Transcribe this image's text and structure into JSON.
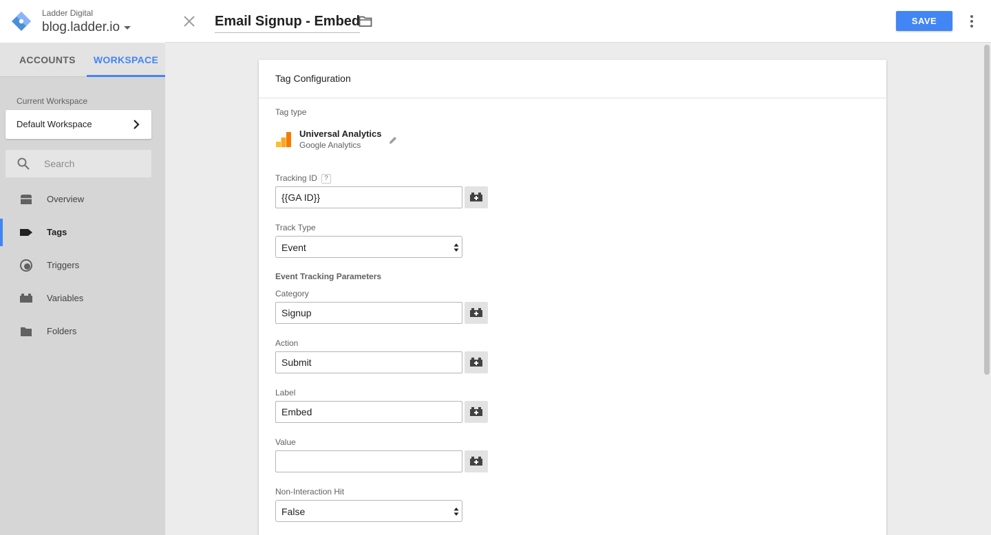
{
  "account": {
    "name": "Ladder Digital",
    "container": "blog.ladder.io"
  },
  "tabs": {
    "accounts": "ACCOUNTS",
    "workspace": "WORKSPACE"
  },
  "workspace": {
    "label": "Current Workspace",
    "name": "Default Workspace"
  },
  "search": {
    "placeholder": "Search"
  },
  "nav": {
    "items": [
      {
        "label": "Overview",
        "icon": "overview-icon"
      },
      {
        "label": "Tags",
        "icon": "tag-icon",
        "active": true
      },
      {
        "label": "Triggers",
        "icon": "trigger-icon"
      },
      {
        "label": "Variables",
        "icon": "variables-icon"
      },
      {
        "label": "Folders",
        "icon": "folder-icon"
      }
    ]
  },
  "header": {
    "title": "Email Signup - Embed",
    "save_label": "SAVE"
  },
  "config": {
    "title": "Tag Configuration",
    "tag_type_label": "Tag type",
    "tag_type_name": "Universal Analytics",
    "tag_type_sub": "Google Analytics",
    "tracking_id_label": "Tracking ID",
    "tracking_id_help": "?",
    "tracking_id_value": "{{GA ID}}",
    "track_type_label": "Track Type",
    "track_type_value": "Event",
    "event_params_title": "Event Tracking Parameters",
    "category_label": "Category",
    "category_value": "Signup",
    "action_label": "Action",
    "action_value": "Submit",
    "label_label": "Label",
    "label_value": "Embed",
    "value_label": "Value",
    "value_value": "",
    "non_interaction_label": "Non-Interaction Hit",
    "non_interaction_value": "False"
  },
  "colors": {
    "accent": "#4285f4",
    "ga_orange": "#f57c00",
    "ga_yellow": "#fbc02d"
  }
}
